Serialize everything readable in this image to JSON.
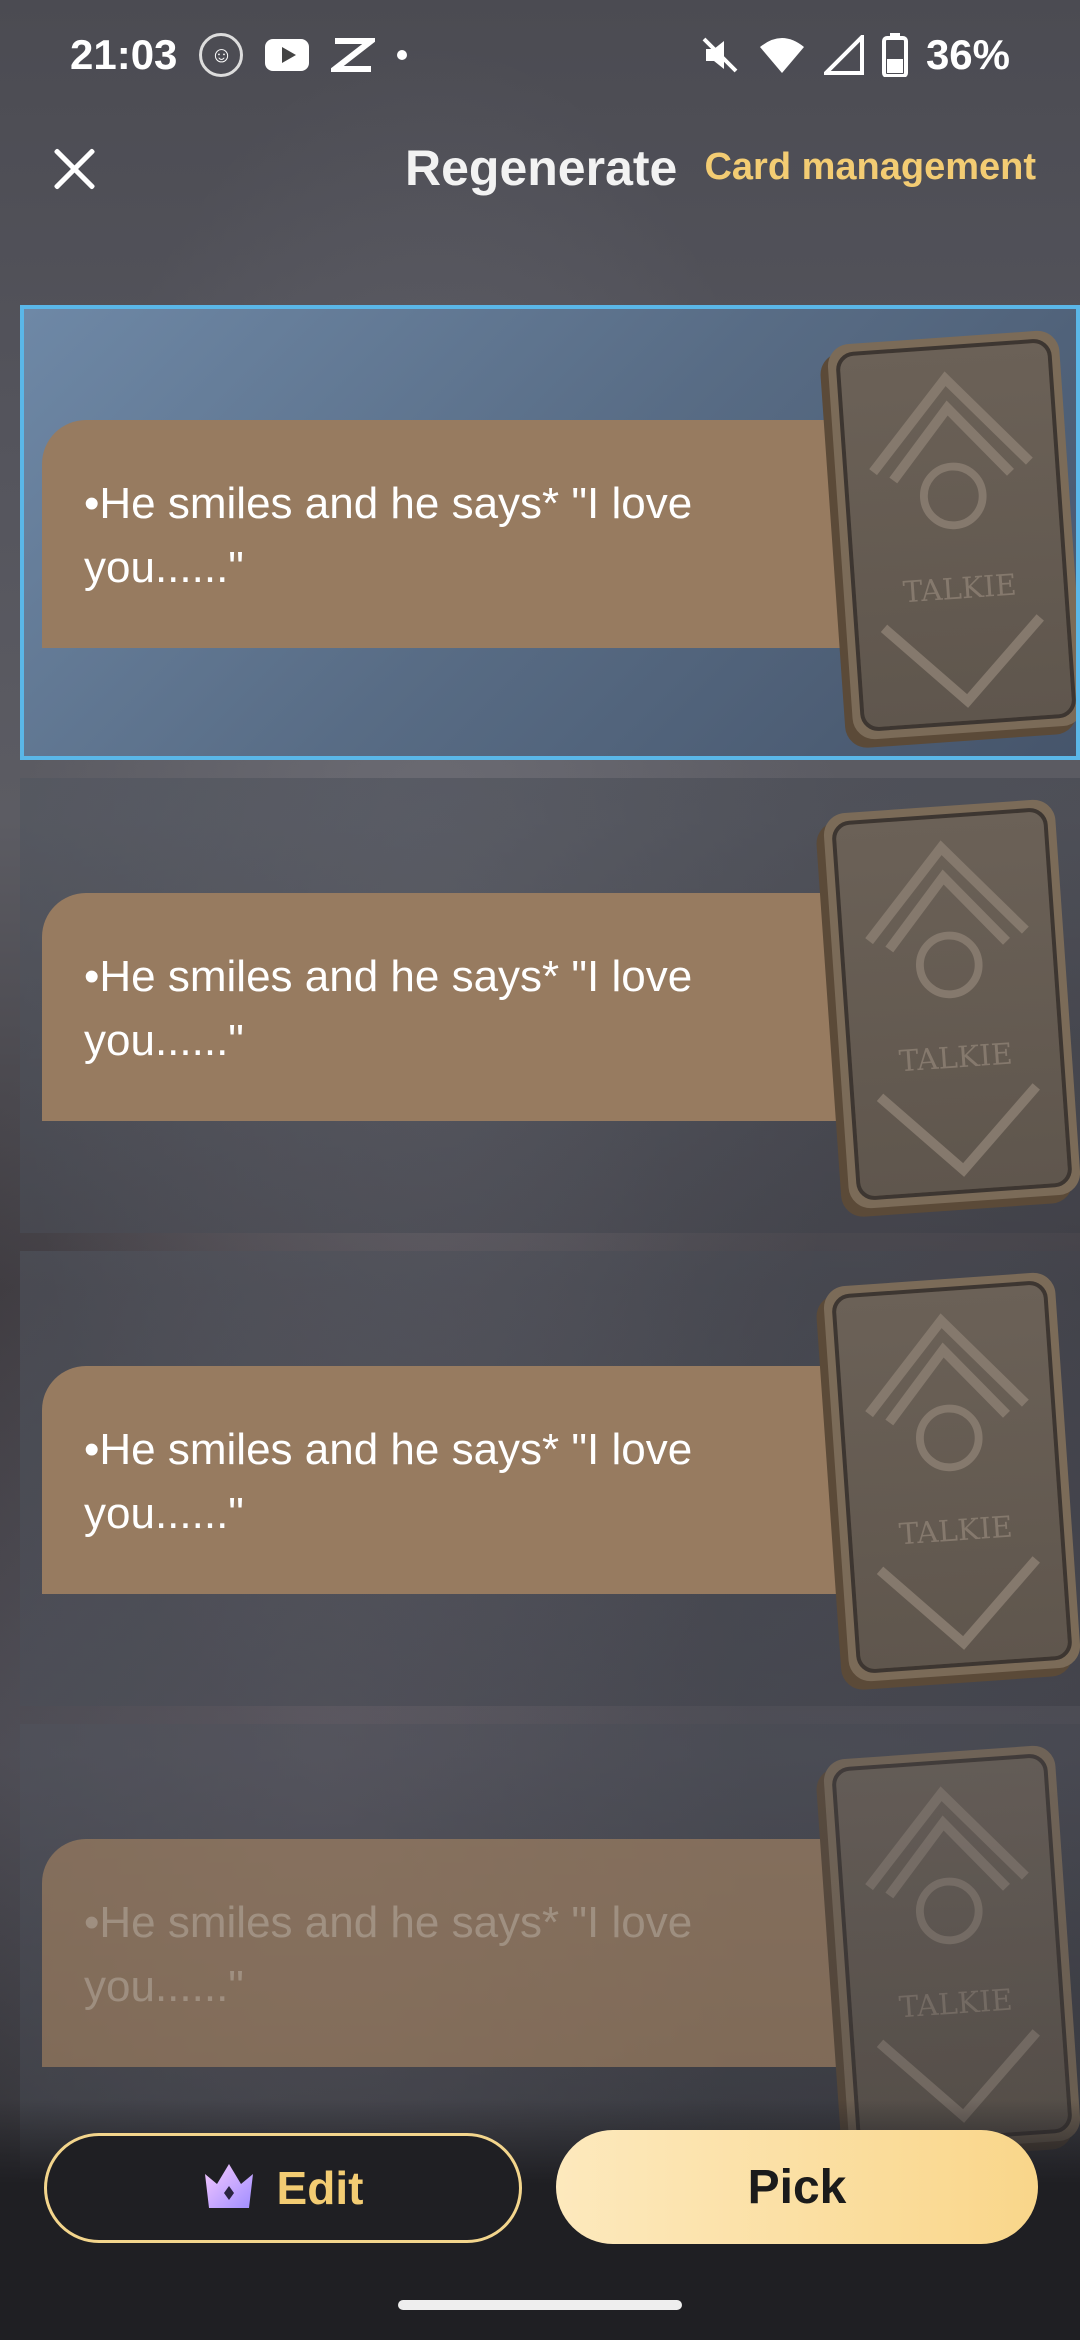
{
  "status_bar": {
    "time": "21:03",
    "battery": "36%",
    "icons": [
      "cat-avatar-icon",
      "youtube-icon",
      "capcut-icon",
      "notification-dot-icon",
      "mute-icon",
      "wifi-icon",
      "signal-icon",
      "battery-icon"
    ]
  },
  "header": {
    "title": "Regenerate",
    "card_management": "Card management"
  },
  "cards": [
    {
      "text": "•He smiles and he says* \"I love you......\"",
      "selected": true,
      "card_brand": "TALKIE"
    },
    {
      "text": "•He smiles and he says* \"I love you......\"",
      "selected": false,
      "card_brand": "TALKIE"
    },
    {
      "text": "•He smiles and he says* \"I love you......\"",
      "selected": false,
      "card_brand": "TALKIE"
    },
    {
      "text": "•He smiles and he says* \"I love you......\"",
      "selected": false,
      "card_brand": "TALKIE"
    }
  ],
  "actions": {
    "edit_label": "Edit",
    "pick_label": "Pick"
  },
  "colors": {
    "accent_gold": "#f3cc73",
    "selected_border": "#5ab7e8",
    "text_box": "#977b60"
  }
}
